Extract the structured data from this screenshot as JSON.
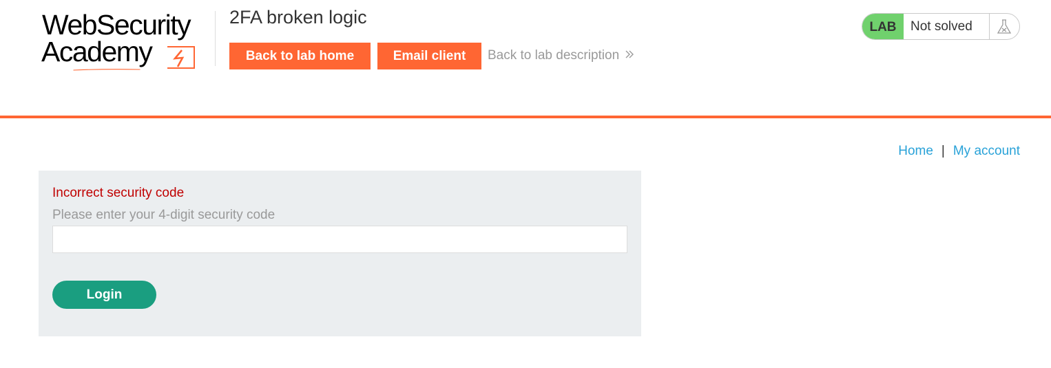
{
  "header": {
    "logo": {
      "line1": "WebSecurity",
      "line2": "Academy"
    },
    "lab_title": "2FA broken logic",
    "buttons": {
      "back_to_lab_home": "Back to lab home",
      "email_client": "Email client"
    },
    "back_to_description": "Back to lab description",
    "status_widget": {
      "badge": "LAB",
      "status": "Not solved",
      "icon": "flask-icon"
    }
  },
  "nav": {
    "home": "Home",
    "separator": "|",
    "my_account": "My account"
  },
  "form": {
    "error": "Incorrect security code",
    "label": "Please enter your 4-digit security code",
    "code_value": "",
    "submit_label": "Login"
  },
  "colors": {
    "accent": "#ff6633",
    "lab_badge": "#70d16d",
    "link": "#29a2d8",
    "error": "#c00000",
    "login_button": "#1a9e80",
    "panel_bg": "#ebeef0"
  }
}
